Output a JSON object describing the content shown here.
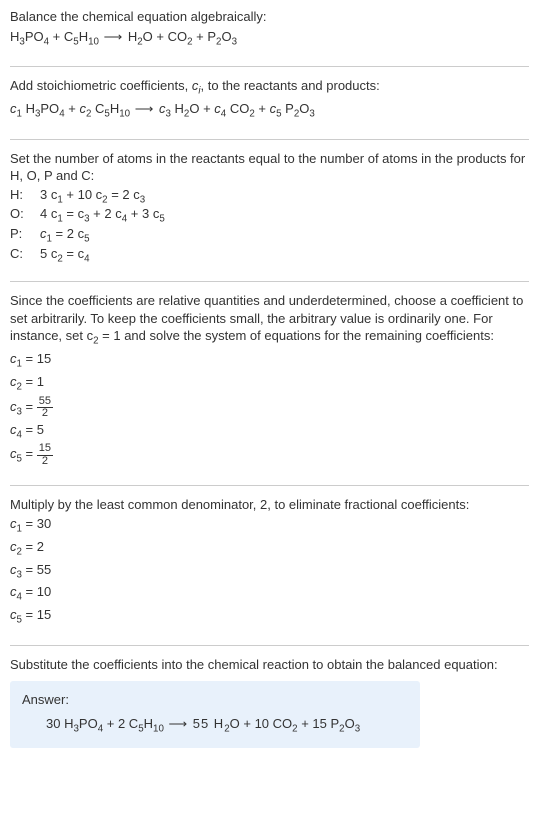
{
  "s1": {
    "t1": "Balance the chemical equation algebraically:"
  },
  "s2": {
    "t1": "Add stoichiometric coefficients, ",
    "t2": ", to the reactants and products:"
  },
  "s3": {
    "t1": "Set the number of atoms in the reactants equal to the number of atoms in the products for H, O, P and C:"
  },
  "eq": {
    "h": {
      "label": "H:",
      "lhs": "3 c",
      "mid": " + 10 c",
      "rhs": " = 2 c"
    },
    "o": {
      "label": "O:",
      "a": "4 c",
      "b": " = c",
      "c": " + 2 c",
      "d": " + 3 c"
    },
    "p": {
      "label": "P:",
      "lhs": "c",
      "rhs": " = 2 c"
    },
    "c": {
      "label": "C:",
      "lhs": "5 c",
      "rhs": " = c"
    }
  },
  "s4": {
    "t1": "Since the coefficients are relative quantities and underdetermined, choose a coefficient to set arbitrarily. To keep the coefficients small, the arbitrary value is ordinarily one. For instance, set c",
    "t2": " = 1 and solve the system of equations for the remaining coefficients:"
  },
  "coef1": {
    "c1": " = 15",
    "c2": " = 1",
    "c3eq": " = ",
    "c3n": "55",
    "c3d": "2",
    "c4": " = 5",
    "c5eq": " = ",
    "c5n": "15",
    "c5d": "2"
  },
  "s5": {
    "t1": "Multiply by the least common denominator, 2, to eliminate fractional coefficients:"
  },
  "coef2": {
    "c1": " = 30",
    "c2": " = 2",
    "c3": " = 55",
    "c4": " = 10",
    "c5": " = 15"
  },
  "s6": {
    "t1": "Substitute the coefficients into the chemical reaction to obtain the balanced equation:"
  },
  "answer": {
    "label": "Answer:",
    "a": "30 H",
    "b": "PO",
    "c": " + 2 C",
    "d": "H",
    "e": " ⟶ 55 H",
    "f": "O + 10 CO",
    "g": " + 15 P",
    "h": "O"
  },
  "chem": {
    "r1a": "H",
    "r1b": "PO",
    "r1c": " + C",
    "r1d": "H",
    "arr": " ⟶ ",
    "p1a": "H",
    "p1b": "O + CO",
    "p1c": " + P",
    "p1d": "O",
    "c": "c",
    "n1": "1",
    "n2": "2",
    "n3": "3",
    "n4": "4",
    "n5": "5",
    "n10": "10",
    "space": " "
  }
}
